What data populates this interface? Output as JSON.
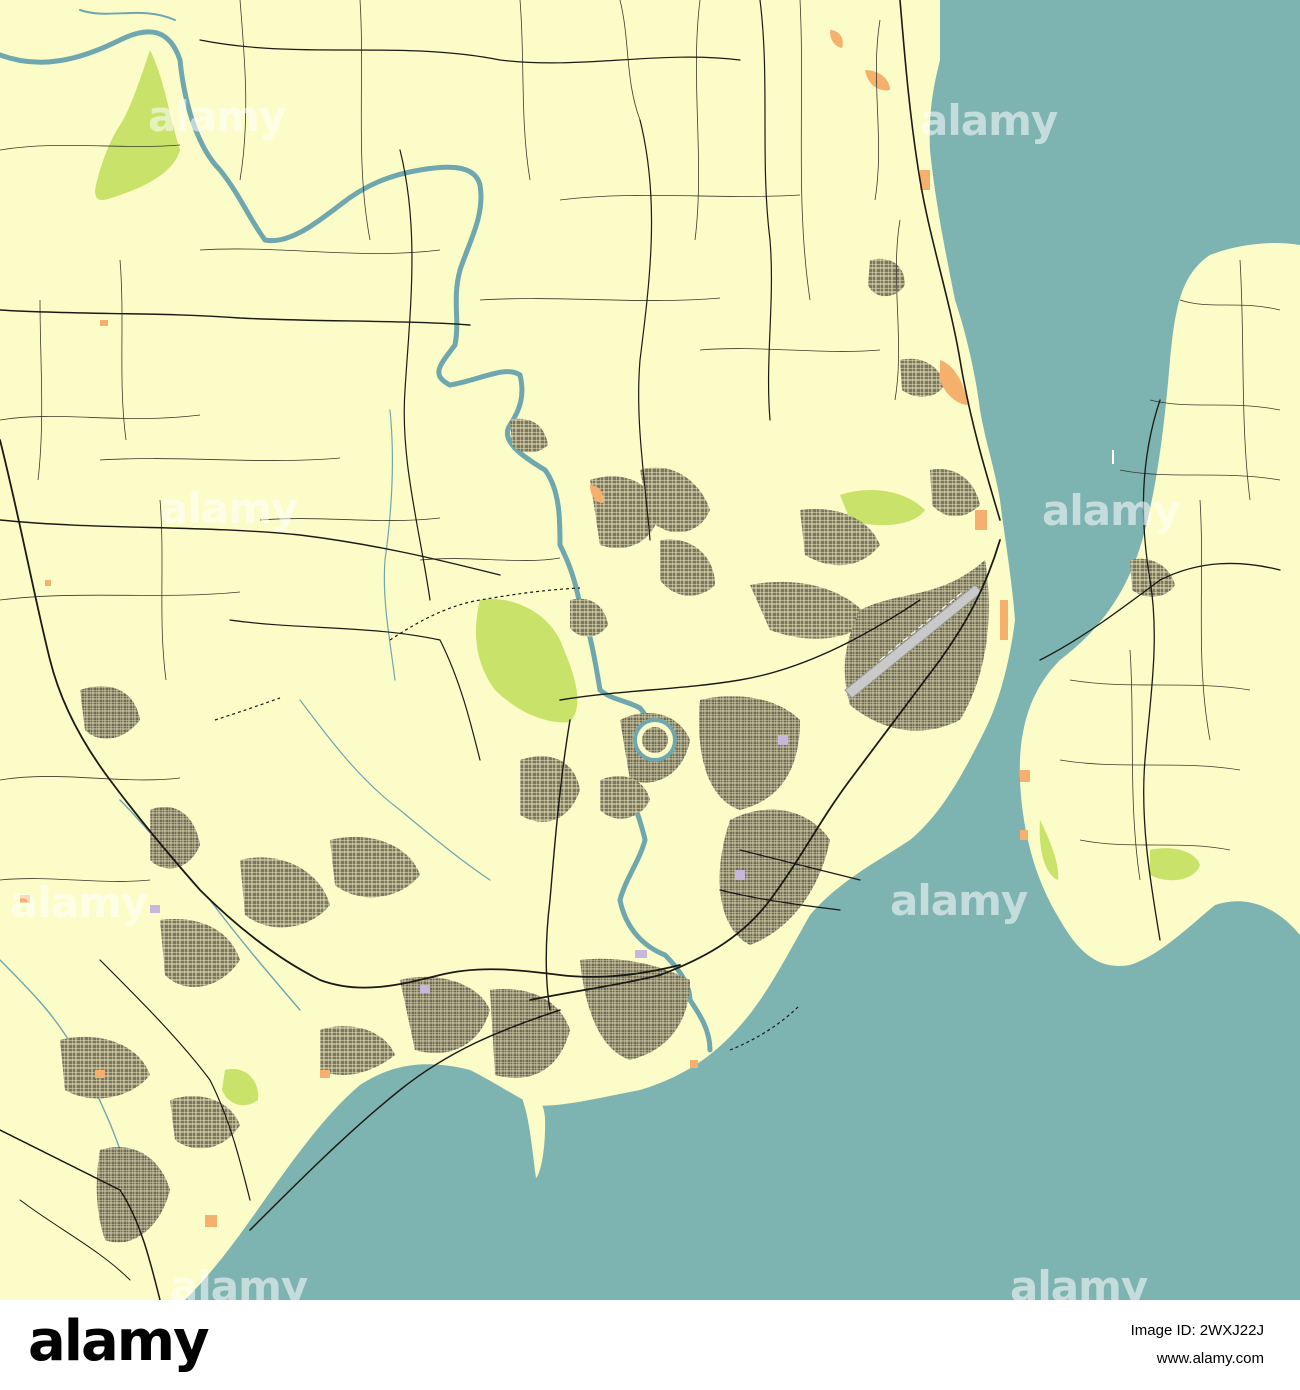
{
  "map": {
    "colors": {
      "land": "#fcfcc8",
      "water": "#7db3b1",
      "river": "#6fa7ae",
      "park": "#c8e26a",
      "residential": "#6e6a56",
      "commercial": "#f6b06d",
      "road": "#1a1a14",
      "minor_road": "#3a3a2c",
      "runway": "#b8b8b8",
      "institution": "#c6b7dc"
    },
    "watermark_text": "alamy",
    "legend": "none"
  },
  "footer": {
    "logo": "alamy",
    "image_id_label": "Image ID: 2WXJ22J",
    "site": "www.alamy.com"
  }
}
